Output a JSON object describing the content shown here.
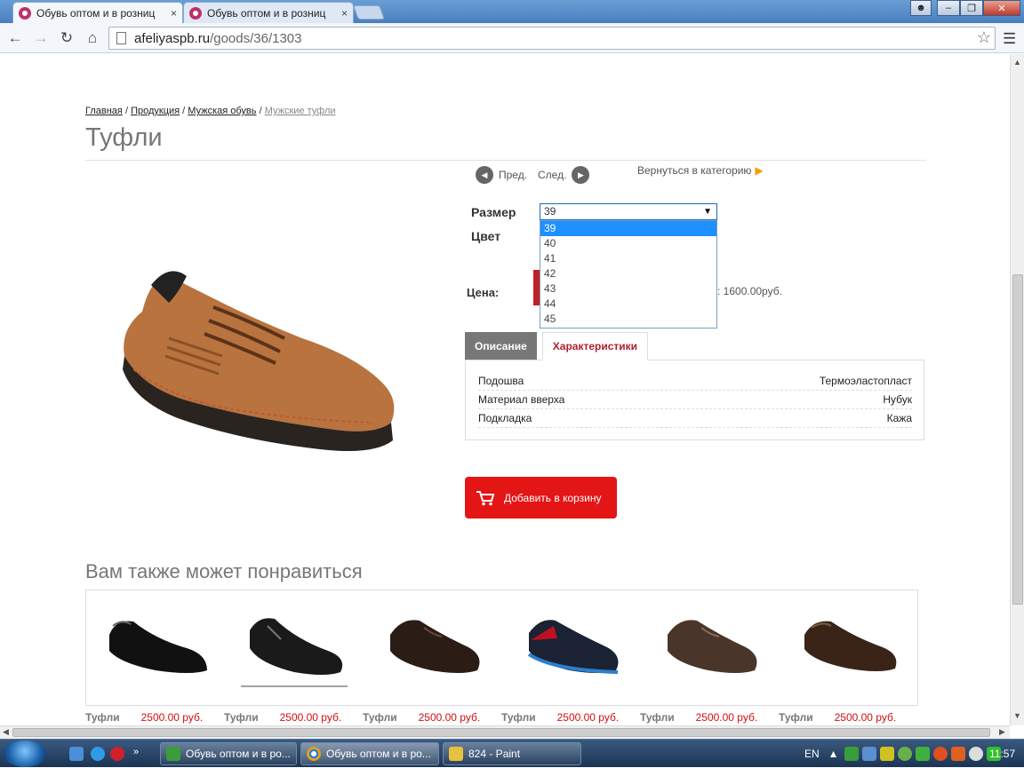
{
  "browser": {
    "tabs": [
      {
        "title": "Обувь оптом и в розниц",
        "close": "×"
      },
      {
        "title": "Обувь оптом и в розниц",
        "close": "×"
      }
    ],
    "url_host": "afeliyaspb.ru",
    "url_path": "/goods/36/1303"
  },
  "breadcrumb": {
    "items": [
      "Главная",
      "Продукция",
      "Мужская обувь"
    ],
    "current": "Мужские туфли",
    "sep": "/"
  },
  "product": {
    "title": "Туфли",
    "prev_label": "Пред.",
    "next_label": "След.",
    "back_label": "Вернуться в категорию",
    "size_label": "Размер",
    "color_label": "Цвет",
    "price_label": "Цена:",
    "size_selected": "39",
    "size_options": [
      "39",
      "40",
      "41",
      "42",
      "43",
      "44",
      "45"
    ],
    "price_tail": ": 1600.00руб.",
    "tabs": [
      "Описание",
      "Характеристики"
    ],
    "specs": [
      {
        "name": "Подошва",
        "value": "Термоэластопласт"
      },
      {
        "name": "Материал вверха",
        "value": "Нубук"
      },
      {
        "name": "Подкладка",
        "value": "Кажа"
      }
    ],
    "cart_label": "Добавить в корзину"
  },
  "related": {
    "heading": "Вам также может понравиться",
    "items": [
      {
        "name": "Туфли",
        "price": "2500.00 руб."
      },
      {
        "name": "Туфли",
        "price": "2500.00 руб."
      },
      {
        "name": "Туфли",
        "price": "2500.00 руб."
      },
      {
        "name": "Туфли",
        "price": "2500.00 руб."
      },
      {
        "name": "Туфли",
        "price": "2500.00 руб."
      },
      {
        "name": "Туфли",
        "price": "2500.00 руб."
      }
    ]
  },
  "taskbar": {
    "buttons": [
      "Обувь оптом и в ро...",
      "Обувь оптом и в ро...",
      "824 - Paint"
    ],
    "lang": "EN",
    "time": "11:57"
  },
  "colors": {
    "accent_red": "#e41515",
    "tab_red": "#b02030",
    "price_red": "#d01010"
  }
}
